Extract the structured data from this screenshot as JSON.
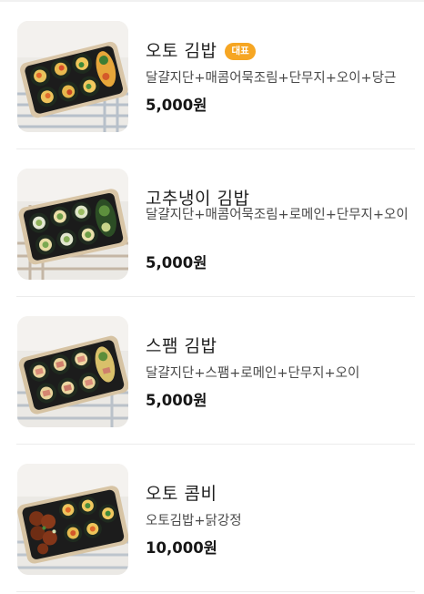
{
  "menu": {
    "items": [
      {
        "name": "오토 김밥",
        "badge": "대표",
        "description": "달걀지단+매콤어묵조림+단무지+오이+당근",
        "price": "5,000원",
        "image": "kimbap-tray-photo"
      },
      {
        "name": "고추냉이 김밥",
        "badge": "",
        "description": "달걀지단+매콤어묵조림+로메인+단무지+오이",
        "price": "5,000원",
        "image": "wasabi-kimbap-tray-photo"
      },
      {
        "name": "스팸 김밥",
        "badge": "",
        "description": "달걀지단+스팸+로메인+단무지+오이",
        "price": "5,000원",
        "image": "spam-kimbap-tray-photo"
      },
      {
        "name": "오토 콤비",
        "badge": "",
        "description": "오토김밥+닭강정",
        "price": "10,000원",
        "image": "combo-kimbap-chicken-tray-photo"
      }
    ]
  }
}
